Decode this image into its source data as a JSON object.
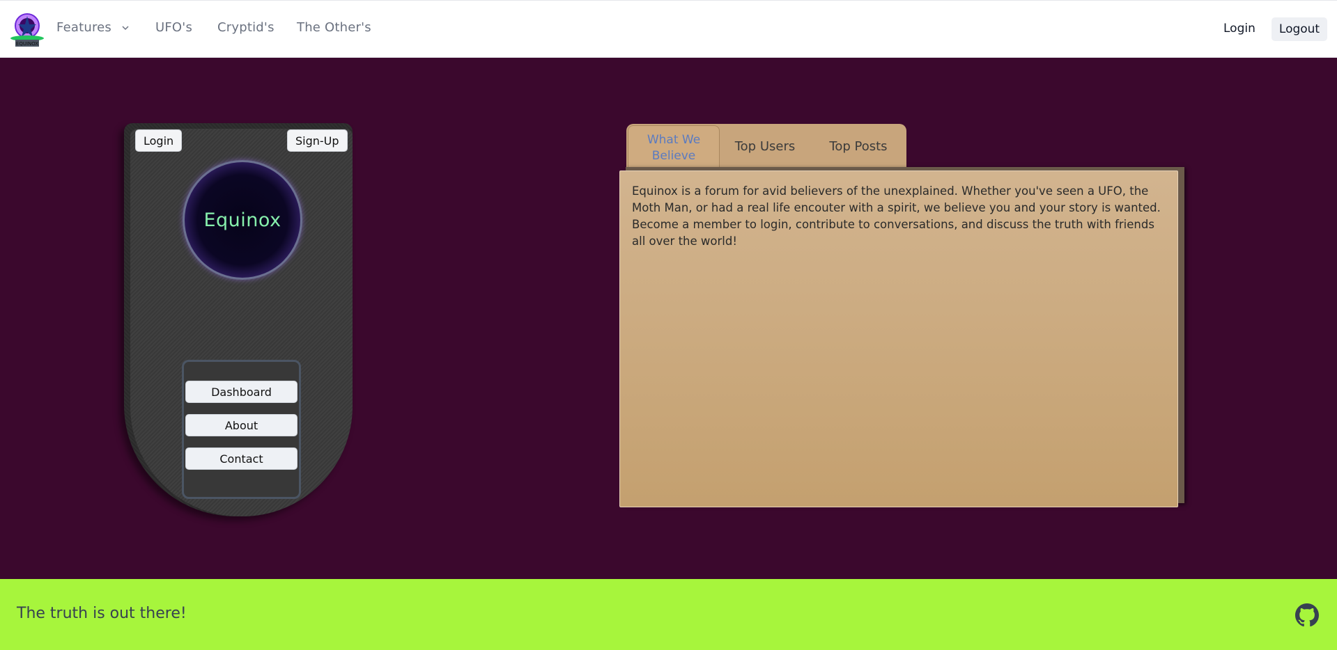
{
  "navbar": {
    "logo_text": "EQUINOX",
    "links": [
      {
        "label": "Features"
      },
      {
        "label": "UFO's"
      },
      {
        "label": "Cryptid's"
      },
      {
        "label": "The Other's"
      }
    ],
    "login_label": "Login",
    "logout_label": "Logout"
  },
  "device": {
    "login_label": "Login",
    "signup_label": "Sign-Up",
    "orb_text": "Equinox",
    "menu": [
      {
        "label": "Dashboard"
      },
      {
        "label": "About"
      },
      {
        "label": "Contact"
      }
    ]
  },
  "info_panel": {
    "tabs": [
      {
        "label": "What We Believe",
        "active": true
      },
      {
        "label": "Top Users",
        "active": false
      },
      {
        "label": "Top Posts",
        "active": false
      }
    ],
    "body": "Equinox is a forum for avid believers of the unexplained. Whether you've seen a UFO, the Moth Man, or had a real life encouter with a spirit, we believe you and your story is wanted. Become a member to login, contribute to conversations, and discuss the truth with friends all over the world!"
  },
  "footer": {
    "tagline": "The truth is out there!",
    "icon": "github-icon"
  },
  "colors": {
    "main_bg": "#3b082d",
    "footer_bg": "#a7f53c",
    "panel_bg": "#cfab80",
    "active_tab_text": "#5b7bc0",
    "orb_text": "#86efac"
  }
}
